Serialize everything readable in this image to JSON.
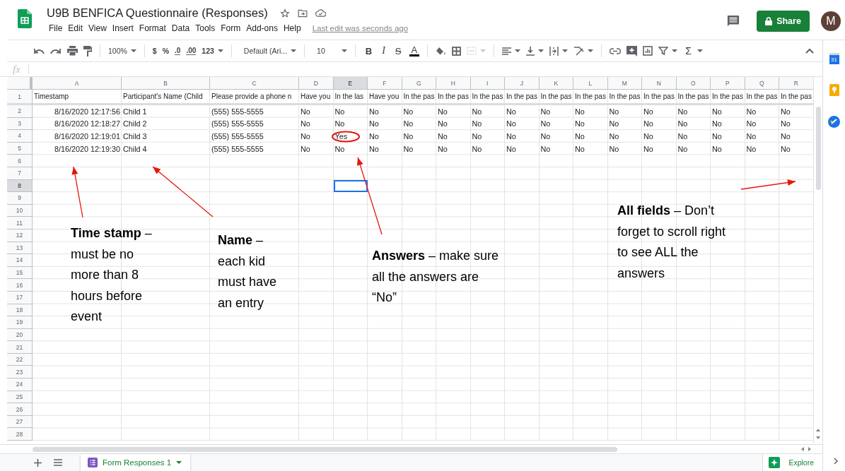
{
  "document": {
    "title": "U9B BENFICA Questionnaire (Responses)",
    "menu": [
      "File",
      "Edit",
      "View",
      "Insert",
      "Format",
      "Data",
      "Tools",
      "Form",
      "Add-ons",
      "Help"
    ],
    "last_edit": "Last edit was seconds ago"
  },
  "share_button": "Share",
  "account": {
    "initial": "M"
  },
  "toolbar": {
    "zoom": "100%",
    "currency": "$",
    "percent": "%",
    "decrease_decimals": ".0",
    "increase_decimals": ".00",
    "more_formats": "123",
    "font": "Default (Ari...",
    "font_size": "10",
    "format_buttons": [
      "B",
      "I",
      "S",
      "A"
    ],
    "function": "Σ"
  },
  "formula_bar": {
    "label": "fx"
  },
  "columns": [
    {
      "letter": "A",
      "selected": false
    },
    {
      "letter": "B",
      "selected": false
    },
    {
      "letter": "C",
      "selected": false
    },
    {
      "letter": "D",
      "selected": false
    },
    {
      "letter": "E",
      "selected": true
    },
    {
      "letter": "F",
      "selected": false
    },
    {
      "letter": "G",
      "selected": false
    },
    {
      "letter": "H",
      "selected": false
    },
    {
      "letter": "I",
      "selected": false
    },
    {
      "letter": "J",
      "selected": false
    },
    {
      "letter": "K",
      "selected": false
    },
    {
      "letter": "L",
      "selected": false
    },
    {
      "letter": "M",
      "selected": false
    },
    {
      "letter": "N",
      "selected": false
    },
    {
      "letter": "O",
      "selected": false
    },
    {
      "letter": "P",
      "selected": false
    },
    {
      "letter": "Q",
      "selected": false
    },
    {
      "letter": "R",
      "selected": false
    }
  ],
  "rows": [
    {
      "number": "1",
      "selected": false,
      "cells": [
        "Timestamp",
        "Participant's Name (Child",
        "Please provide a phone n",
        "Have you",
        "In the las",
        "Have you",
        "In the pas",
        "In the pas",
        "In the pas",
        "In the pas",
        "In the pas",
        "In the pas",
        "In the pas",
        "In the pas",
        "In the pas",
        "In the pas",
        "In the pas",
        "In the pas"
      ]
    },
    {
      "number": "2",
      "selected": false,
      "cells": [
        "8/16/2020 12:17:56",
        "Child 1",
        "(555) 555-5555",
        "No",
        "No",
        "No",
        "No",
        "No",
        "No",
        "No",
        "No",
        "No",
        "No",
        "No",
        "No",
        "No",
        "No",
        "No"
      ]
    },
    {
      "number": "3",
      "selected": false,
      "cells": [
        "8/16/2020 12:18:27",
        "Child 2",
        "(555) 555-5555",
        "No",
        "No",
        "No",
        "No",
        "No",
        "No",
        "No",
        "No",
        "No",
        "No",
        "No",
        "No",
        "No",
        "No",
        "No"
      ]
    },
    {
      "number": "4",
      "selected": false,
      "cells": [
        "8/16/2020 12:19:01",
        "Child 3",
        "(555) 555-5555",
        "No",
        "Yes",
        "No",
        "No",
        "No",
        "No",
        "No",
        "No",
        "No",
        "No",
        "No",
        "No",
        "No",
        "No",
        "No"
      ]
    },
    {
      "number": "5",
      "selected": false,
      "cells": [
        "8/16/2020 12:19:30",
        "Child 4",
        "(555) 555-5555",
        "No",
        "No",
        "No",
        "No",
        "No",
        "No",
        "No",
        "No",
        "No",
        "No",
        "No",
        "No",
        "No",
        "No",
        "No"
      ]
    },
    {
      "number": "6",
      "selected": false
    },
    {
      "number": "7",
      "selected": false
    },
    {
      "number": "8",
      "selected": true
    },
    {
      "number": "9",
      "selected": false
    },
    {
      "number": "10",
      "selected": false
    },
    {
      "number": "11",
      "selected": false
    },
    {
      "number": "12",
      "selected": false
    },
    {
      "number": "13",
      "selected": false
    },
    {
      "number": "14",
      "selected": false
    },
    {
      "number": "15",
      "selected": false
    },
    {
      "number": "16",
      "selected": false
    },
    {
      "number": "17",
      "selected": false
    },
    {
      "number": "18",
      "selected": false
    },
    {
      "number": "19",
      "selected": false
    },
    {
      "number": "20",
      "selected": false
    },
    {
      "number": "21",
      "selected": false
    },
    {
      "number": "22",
      "selected": false
    },
    {
      "number": "23",
      "selected": false
    },
    {
      "number": "24",
      "selected": false
    },
    {
      "number": "25",
      "selected": false
    },
    {
      "number": "26",
      "selected": false
    },
    {
      "number": "27",
      "selected": false
    },
    {
      "number": "28",
      "selected": false
    }
  ],
  "sheet_tabs": [
    {
      "label": "Form Responses 1",
      "selected": true
    }
  ],
  "explore_button": "Explore",
  "side_panel": [
    {
      "kind": "calendar",
      "label": "31"
    },
    {
      "kind": "keep"
    },
    {
      "kind": "tasks"
    }
  ],
  "notes": [
    {
      "text": "**Time stamp** – must be no more than 8 hours before event"
    },
    {
      "text": "**Name** – each kid must have an entry"
    },
    {
      "text": "**Answers** – make sure all the answers are “No”"
    },
    {
      "text": "**All fields** – Don’t forget to scroll right to see ALL the answers"
    }
  ]
}
